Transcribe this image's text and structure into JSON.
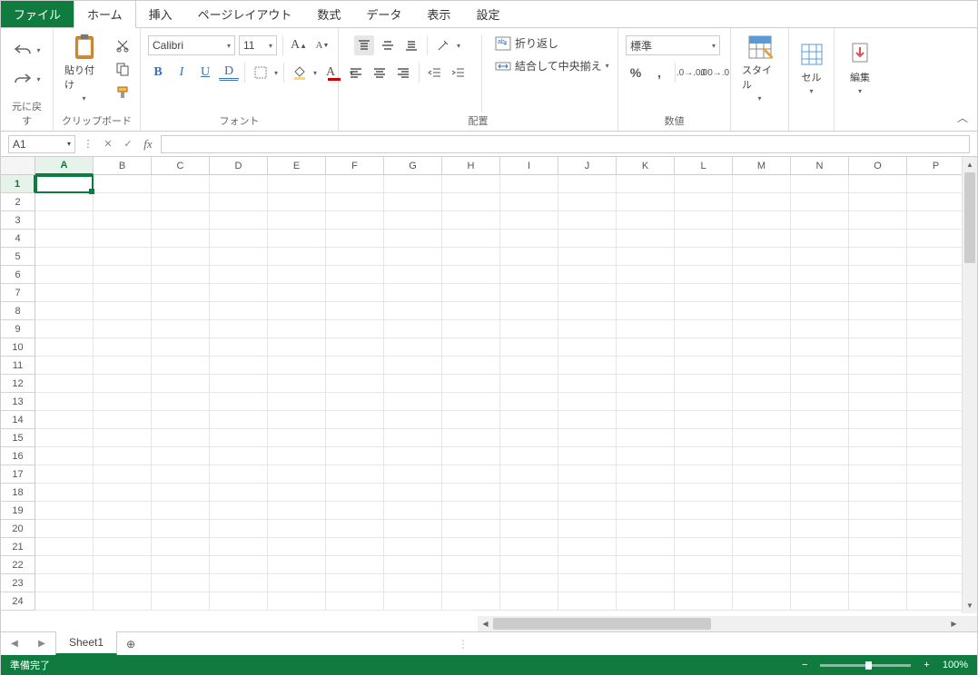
{
  "tabs": {
    "file": "ファイル",
    "home": "ホーム",
    "insert": "挿入",
    "pagelayout": "ページレイアウト",
    "formulas": "数式",
    "data": "データ",
    "view": "表示",
    "settings": "設定"
  },
  "groups": {
    "undo": "元に戻す",
    "clipboard": "クリップボード",
    "paste": "貼り付け",
    "font": "フォント",
    "alignment": "配置",
    "number": "数値",
    "wrap": "折り返し",
    "merge": "結合して中央揃え",
    "styles": "スタイル",
    "cells": "セル",
    "editing": "編集"
  },
  "font": {
    "name": "Calibri",
    "size": "11"
  },
  "number_format": "標準",
  "namebox": "A1",
  "formula": "",
  "columns": [
    "A",
    "B",
    "C",
    "D",
    "E",
    "F",
    "G",
    "H",
    "I",
    "J",
    "K",
    "L",
    "M",
    "N",
    "O",
    "P"
  ],
  "rows": [
    "1",
    "2",
    "3",
    "4",
    "5",
    "6",
    "7",
    "8",
    "9",
    "10",
    "11",
    "12",
    "13",
    "14",
    "15",
    "16",
    "17",
    "18",
    "19",
    "20",
    "21",
    "22",
    "23",
    "24"
  ],
  "sheet_tab": "Sheet1",
  "status": {
    "ready": "準備完了",
    "zoom": "100%"
  }
}
